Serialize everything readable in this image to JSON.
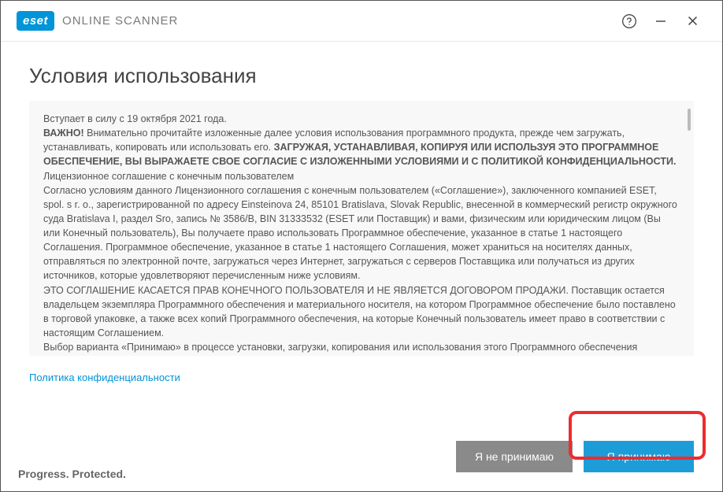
{
  "header": {
    "logo_text": "eset",
    "product_name": "ONLINE SCANNER"
  },
  "page": {
    "title": "Условия использования",
    "privacy_link": "Политика конфиденциальности",
    "tagline": "Progress. Protected."
  },
  "terms": {
    "effective": "Вступает в силу с 19 октября 2021 года.",
    "important_label": "ВАЖНО!",
    "important_text": " Внимательно прочитайте изложенные далее условия использования программного продукта, прежде чем загружать, устанавливать, копировать или использовать его. ",
    "bold_clause": "ЗАГРУЖАЯ, УСТАНАВЛИВАЯ, КОПИРУЯ ИЛИ ИСПОЛЬЗУЯ ЭТО ПРОГРАММНОЕ ОБЕСПЕЧЕНИЕ, ВЫ ВЫРАЖАЕТЕ СВОЕ СОГЛАСИЕ С ИЗЛОЖЕННЫМИ УСЛОВИЯМИ И С ПОЛИТИКОЙ КОНФИДЕНЦИАЛЬНОСТИ.",
    "eula_title": "Лицензионное соглашение с конечным пользователем",
    "para1": "Согласно условиям данного Лицензионного соглашения с конечным пользователем («Соглашение»), заключенного компанией ESET, spol. s r. o., зарегистрированной по адресу Einsteinova 24, 85101 Bratislava, Slovak Republic, внесенной в коммерческий регистр окружного суда Bratislava I, раздел Sro, запись № 3586/B, BIN 31333532 (ESET или Поставщик) и вами, физическим или юридическим лицом (Вы или Конечный пользователь), Вы получаете право использовать Программное обеспечение, указанное в статье 1 настоящего Соглашения. Программное обеспечение, указанное в статье 1 настоящего Соглашения, может храниться на носителях данных, отправляться по электронной почте, загружаться через Интернет, загружаться с серверов Поставщика или получаться из других источников, которые удовлетворяют перечисленным ниже условиям.",
    "para2": "ЭТО СОГЛАШЕНИЕ КАСАЕТСЯ ПРАВ КОНЕЧНОГО ПОЛЬЗОВАТЕЛЯ И НЕ ЯВЛЯЕТСЯ ДОГОВОРОМ ПРОДАЖИ. Поставщик остается владельцем экземпляра Программного обеспечения и материального носителя, на котором Программное обеспечение было поставлено в торговой упаковке, а также всех копий Программного обеспечения, на которые Конечный пользователь имеет право в соответствии с настоящим Соглашением.",
    "para3": "Выбор варианта «Принимаю» в процессе установки, загрузки, копирования или использования этого Программного обеспечения выражает Ваше согласие с условиями настоящего Соглашения и Политики конфиденциальности. Если Вы не согласны с каким-либо из условий настоящего Соглашения или Политики конфиденциальности, немедленно выберите вариант отмены, отмените установку или загрузку, уничтожьте или верните Программное обеспечение, установочные носители, сопроводительную документацию, а также квитанции об оплате Поставщику или в организацию, в которой было приобретено Программное обеспечение."
  },
  "buttons": {
    "decline": "Я не принимаю",
    "accept": "Я принимаю"
  }
}
